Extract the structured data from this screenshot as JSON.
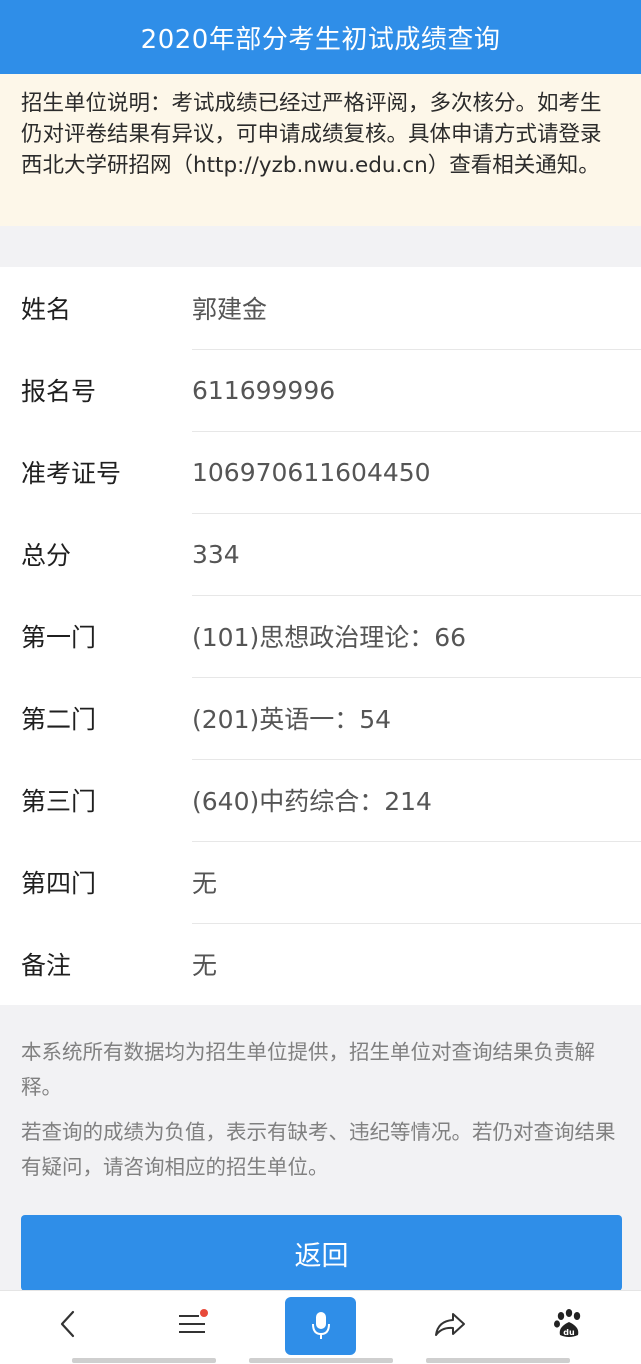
{
  "header": {
    "title": "2020年部分考生初试成绩查询"
  },
  "notice": {
    "text": "招生单位说明：考试成绩已经过严格评阅，多次核分。如考生仍对评卷结果有异议，可申请成绩复核。具体申请方式请登录西北大学研招网（http://yzb.nwu.edu.cn）查看相关通知。"
  },
  "info": {
    "rows": [
      {
        "label": "姓名",
        "value": "郭建金"
      },
      {
        "label": "报名号",
        "value": "611699996"
      },
      {
        "label": "准考证号",
        "value": "106970611604450"
      },
      {
        "label": "总分",
        "value": "334"
      },
      {
        "label": "第一门",
        "value": "(101)思想政治理论：66"
      },
      {
        "label": "第二门",
        "value": "(201)英语一：54"
      },
      {
        "label": "第三门",
        "value": "(640)中药综合：214"
      },
      {
        "label": "第四门",
        "value": "无"
      },
      {
        "label": "备注",
        "value": "无"
      }
    ]
  },
  "footnotes": {
    "line1": "本系统所有数据均为招生单位提供，招生单位对查询结果负责解释。",
    "line2": "若查询的成绩为负值，表示有缺考、违纪等情况。若仍对查询结果有疑问，请咨询相应的招生单位。"
  },
  "actions": {
    "back_label": "返回"
  },
  "bottom_bar": {
    "items": [
      "back-arrow-icon",
      "menu-icon",
      "microphone-icon",
      "share-icon",
      "baidu-paw-icon"
    ]
  },
  "colors": {
    "primary": "#2f8ee8",
    "notice_bg": "#fdf7e9",
    "badge": "#e84a3a"
  }
}
